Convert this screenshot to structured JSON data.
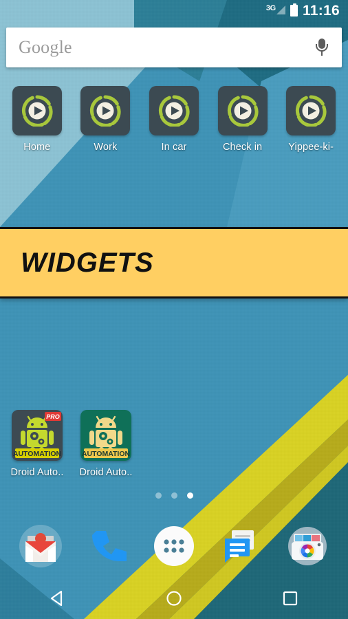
{
  "device": {
    "platform": "Android",
    "screen": "home-screen"
  },
  "status_bar": {
    "network_label": "3G",
    "network_icon": "signal-triangle-icon",
    "battery_icon": "battery-full-icon",
    "clock": "11:16"
  },
  "search": {
    "brand": "Google",
    "placeholder": "Google",
    "mic_icon": "microphone-icon"
  },
  "shortcuts": [
    {
      "label": "Home",
      "icon": "tasker-play-icon"
    },
    {
      "label": "Work",
      "icon": "tasker-play-icon"
    },
    {
      "label": "In car",
      "icon": "tasker-play-icon"
    },
    {
      "label": "Check in",
      "icon": "tasker-play-icon"
    },
    {
      "label": "Yippee-ki-",
      "icon": "tasker-play-icon"
    }
  ],
  "widgets_banner": {
    "title": "WIDGETS",
    "background": "#ffcf62",
    "text_color": "#111111"
  },
  "apps": [
    {
      "label": "Droid Auto..",
      "icon": "droid-automation-pro-icon",
      "badge": "PRO",
      "background": "#3d4a52"
    },
    {
      "label": "Droid Auto..",
      "icon": "droid-automation-icon",
      "badge": "",
      "background": "#0f7058"
    }
  ],
  "icon_text": {
    "automation": "AUTOMATION"
  },
  "page_indicator": {
    "count": 3,
    "active_index": 2
  },
  "dock": [
    {
      "label": "Gmail",
      "icon": "gmail-icon"
    },
    {
      "label": "Phone",
      "icon": "phone-icon"
    },
    {
      "label": "Apps",
      "icon": "app-drawer-icon"
    },
    {
      "label": "Messages",
      "icon": "messages-icon"
    },
    {
      "label": "Camera",
      "icon": "camera-icon"
    }
  ],
  "nav_bar": [
    {
      "label": "Back",
      "icon": "back-triangle-icon"
    },
    {
      "label": "Home",
      "icon": "home-circle-icon"
    },
    {
      "label": "Recents",
      "icon": "recents-square-icon"
    }
  ],
  "colors": {
    "wallpaper_blue": "#3f93b6",
    "wallpaper_dark_teal": "#1d6a80",
    "wallpaper_pale_blue": "#8fc4d4",
    "wallpaper_yellow": "#d4cf22",
    "tasker_slate": "#3c4a52",
    "tasker_lime": "#a8c83c",
    "banner_yellow": "#ffcf62"
  }
}
